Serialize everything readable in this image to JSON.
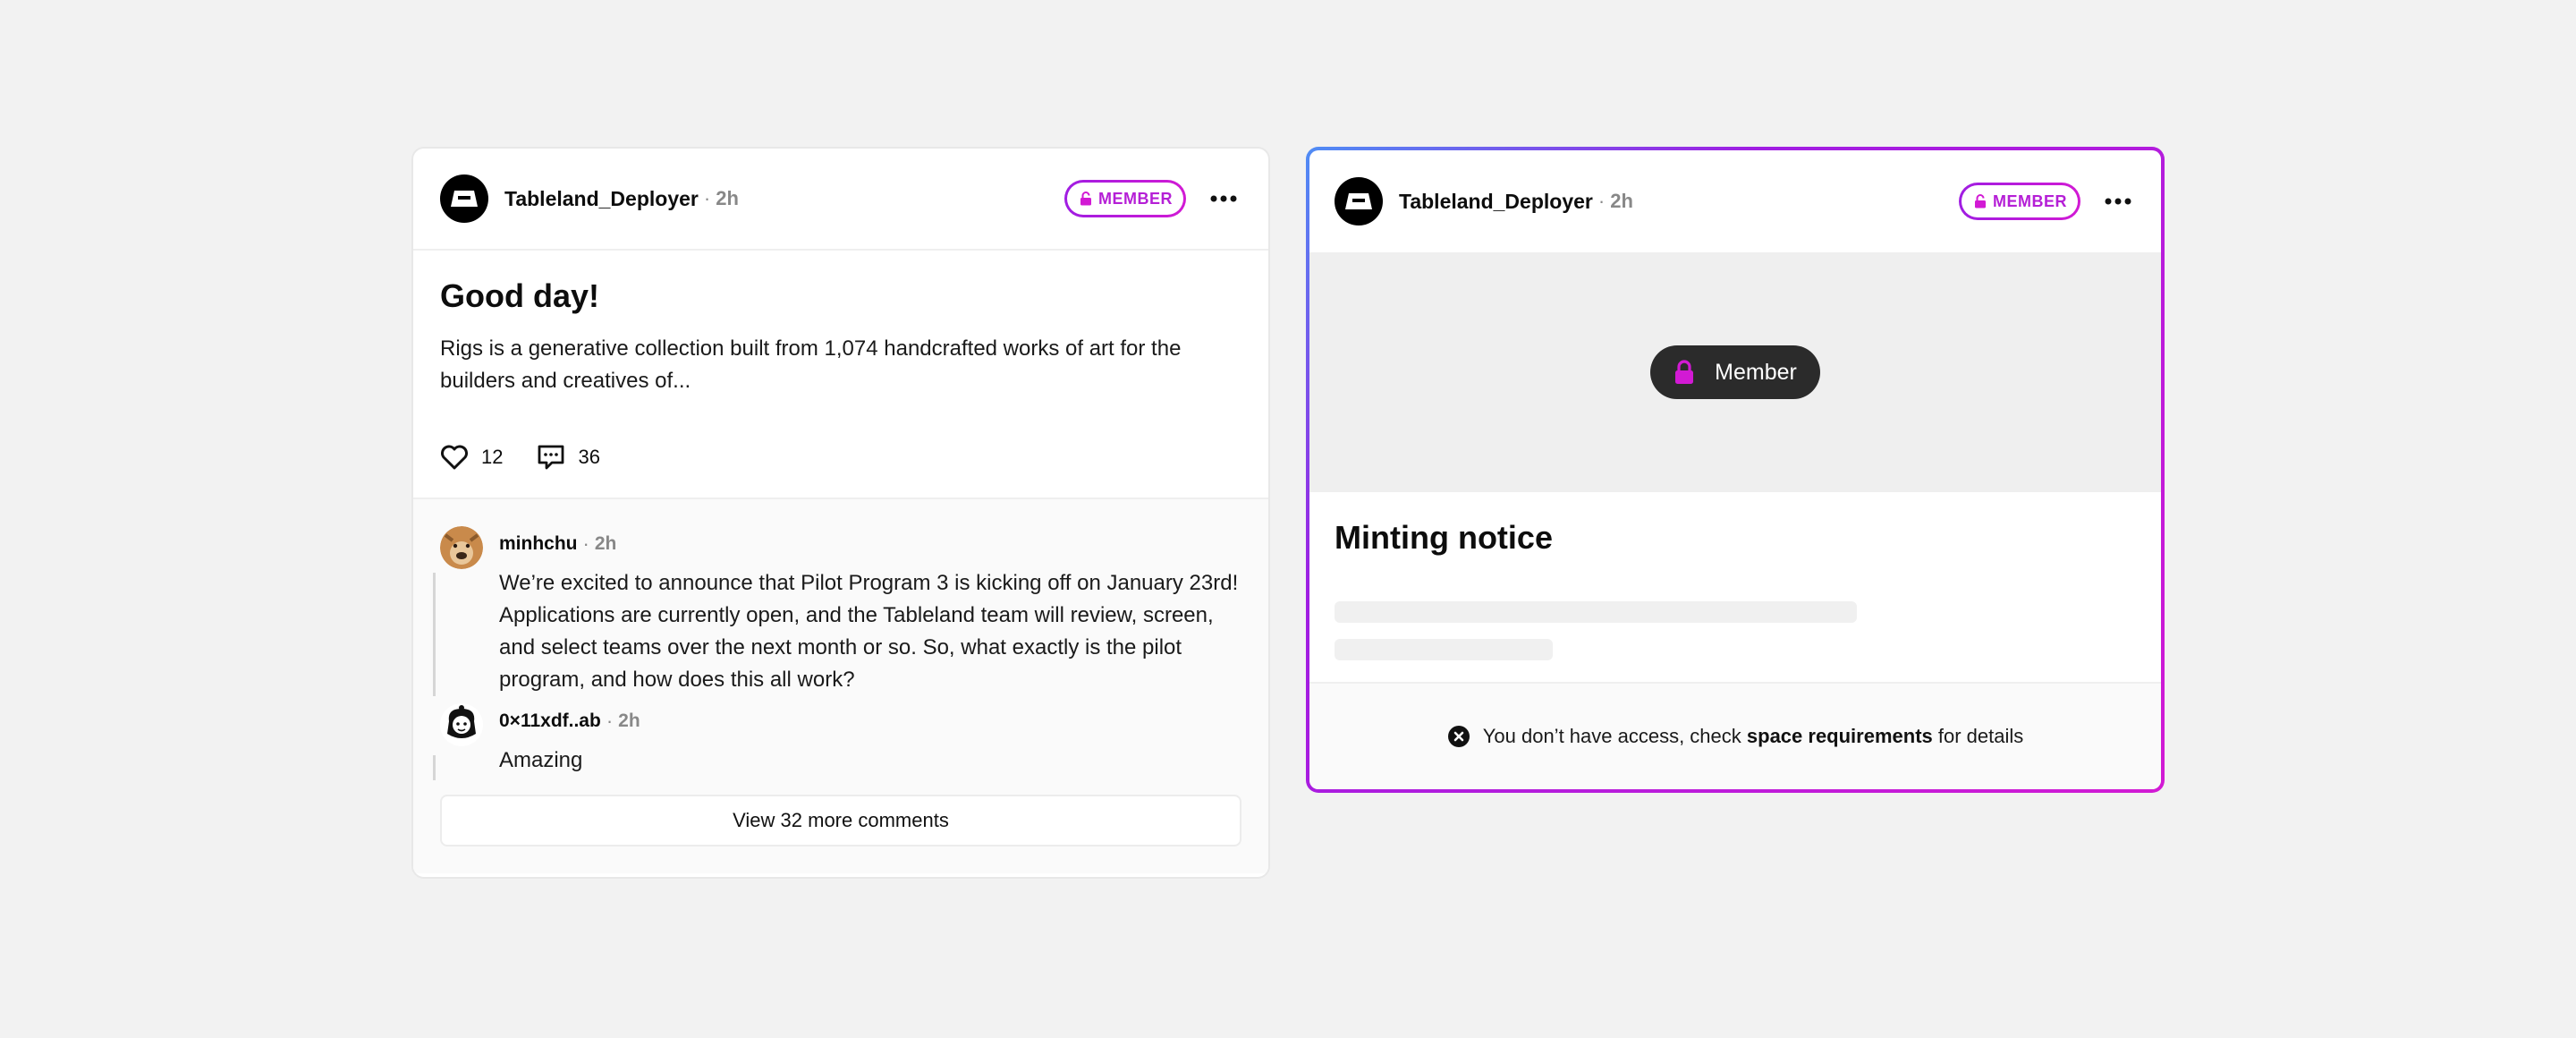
{
  "card1": {
    "author": "Tableland_Deployer",
    "separator": "·",
    "time": "2h",
    "badge": "MEMBER",
    "more_icon": "more-horizontal-icon",
    "title": "Good day!",
    "text": "Rigs is a generative collection built from 1,074 handcrafted works of art for the builders and creatives of...",
    "likes": "12",
    "comments_count": "36",
    "comments": [
      {
        "author": "minhchu",
        "time": "2h",
        "text": "We’re excited to announce that Pilot Program 3 is kicking off on January 23rd! Applications are currently open, and the Tableland team will review, screen, and select teams over the next month or so. So, what exactly is the pilot program, and how does this all work?"
      },
      {
        "author": "0×11xdf..ab",
        "time": "2h",
        "text": "Amazing"
      }
    ],
    "view_more": "View 32 more comments"
  },
  "card2": {
    "author": "Tableland_Deployer",
    "separator": "·",
    "time": "2h",
    "badge": "MEMBER",
    "locked_label": "Member",
    "title": "Minting notice",
    "access_prefix": "You don’t have access, check ",
    "access_link": "space requirements",
    "access_suffix": " for details"
  },
  "colors": {
    "accent": "#b51fd6",
    "gradient_start": "#4f8df5",
    "pill_bg": "#2b2b2b",
    "lock_icon": "#d21ad4"
  },
  "icons": [
    "tableland-logo-icon",
    "lock-icon",
    "heart-icon",
    "comment-icon",
    "more-horizontal-icon",
    "close-circle-icon"
  ]
}
